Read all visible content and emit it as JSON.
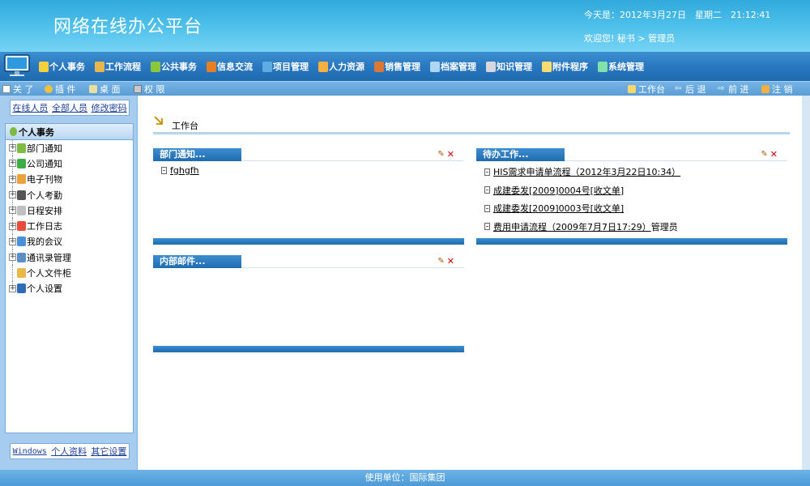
{
  "header": {
    "title": "网络在线办公平台",
    "date_line": "今天是：2012年3月27日　星期二　21:12:41",
    "welcome_line": "欢迎您!  秘书 > 管理员"
  },
  "menu": [
    {
      "label": "个人事务",
      "icon": "person-icon",
      "color": "#f4d03f"
    },
    {
      "label": "工作流程",
      "icon": "workflow-icon",
      "color": "#e9b64c"
    },
    {
      "label": "公共事务",
      "icon": "people-icon",
      "color": "#8dc63f"
    },
    {
      "label": "信息交流",
      "icon": "chat-icon",
      "color": "#e67e22"
    },
    {
      "label": "项目管理",
      "icon": "project-icon",
      "color": "#5dade2"
    },
    {
      "label": "人力资源",
      "icon": "hr-icon",
      "color": "#f5b041"
    },
    {
      "label": "销售管理",
      "icon": "sales-icon",
      "color": "#dc7633"
    },
    {
      "label": "档案管理",
      "icon": "archive-icon",
      "color": "#aed6f1"
    },
    {
      "label": "知识管理",
      "icon": "knowledge-icon",
      "color": "#d5d8dc"
    },
    {
      "label": "附件程序",
      "icon": "attachment-icon",
      "color": "#f7dc6f"
    },
    {
      "label": "系统管理",
      "icon": "system-icon",
      "color": "#82e0aa"
    }
  ],
  "subbar": {
    "left": [
      {
        "label": "关 了",
        "icon": "page-icon"
      },
      {
        "label": "插 件",
        "icon": "plugin-icon"
      },
      {
        "label": "桌 面",
        "icon": "desktop-icon"
      },
      {
        "label": "权 限",
        "icon": "permission-icon"
      }
    ],
    "right": [
      {
        "label": "工作台",
        "icon": "home-icon"
      },
      {
        "label": "后 退",
        "icon": "back-icon"
      },
      {
        "label": "前 进",
        "icon": "forward-icon"
      },
      {
        "label": "注 销",
        "icon": "logout-icon"
      }
    ]
  },
  "sidebar": {
    "top_links": [
      "在线人员",
      "全部人员",
      "修改密码"
    ],
    "tree_header": "个人事务",
    "tree_items": [
      {
        "label": "部门通知",
        "expandable": true,
        "icon": "notice-icon",
        "color": "#7dbb42"
      },
      {
        "label": "公司通知",
        "expandable": true,
        "icon": "star-icon",
        "color": "#3fae49"
      },
      {
        "label": "电子刊物",
        "expandable": true,
        "icon": "folder-icon",
        "color": "#e8a33d"
      },
      {
        "label": "个人考勤",
        "expandable": true,
        "icon": "attendance-icon",
        "color": "#555555"
      },
      {
        "label": "日程安排",
        "expandable": true,
        "icon": "calendar-icon",
        "color": "#c0c0c0"
      },
      {
        "label": "工作日志",
        "expandable": true,
        "icon": "notebook-icon",
        "color": "#e74c3c"
      },
      {
        "label": "我的会议",
        "expandable": true,
        "icon": "meeting-icon",
        "color": "#4a90d9"
      },
      {
        "label": "通讯录管理",
        "expandable": true,
        "icon": "addressbook-icon",
        "color": "#5d8fc7"
      },
      {
        "label": "个人文件柜",
        "expandable": false,
        "icon": "cabinet-icon",
        "color": "#e8b84a"
      },
      {
        "label": "个人设置",
        "expandable": true,
        "icon": "settings-icon",
        "color": "#2e6bb8"
      }
    ],
    "bottom_links": [
      "Windows",
      "个人资料",
      "其它设置"
    ]
  },
  "workspace": {
    "title": "工作台",
    "panels": {
      "dept_notice": {
        "title": "部门通知...",
        "items": [
          {
            "link": "fghgfh",
            "extra": ""
          }
        ]
      },
      "todo": {
        "title": "待办工作...",
        "items": [
          {
            "link": "HIS需求申请单流程（2012年3月22日10:34）",
            "extra": ""
          },
          {
            "link": "成建委发[2009]0004号[收文单]",
            "extra": ""
          },
          {
            "link": "成建委发[2009]0003号[收文单]",
            "extra": ""
          },
          {
            "link": "费用申请流程（2009年7月7日17:29）",
            "extra": "管理员"
          }
        ]
      },
      "mail": {
        "title": "内部邮件...",
        "items": []
      }
    }
  },
  "footer": {
    "text": "使用单位：国际集团"
  }
}
